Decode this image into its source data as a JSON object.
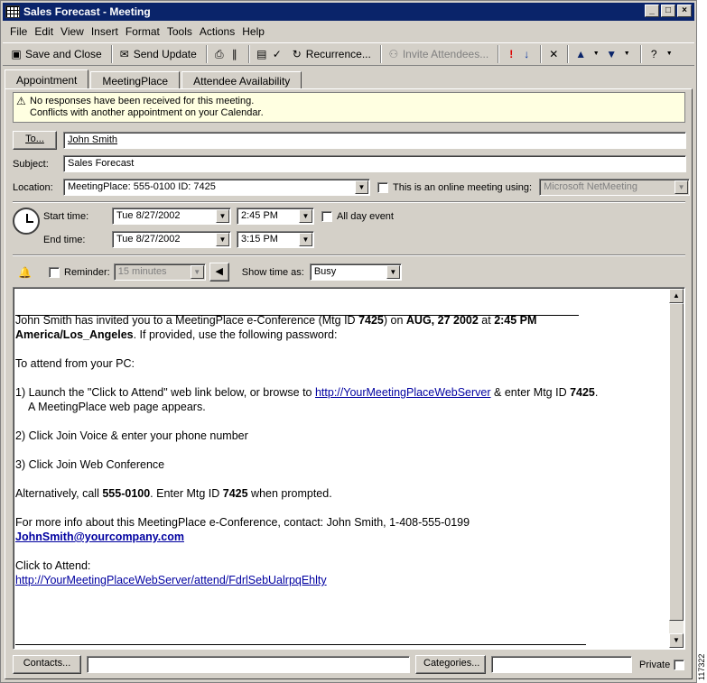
{
  "window": {
    "title": "Sales Forecast - Meeting",
    "controls": [
      "_",
      "□",
      "×"
    ]
  },
  "menu": [
    "File",
    "Edit",
    "View",
    "Insert",
    "Format",
    "Tools",
    "Actions",
    "Help"
  ],
  "toolbar": {
    "save_close": "Save and Close",
    "send_update": "Send Update",
    "recurrence": "Recurrence...",
    "invite": "Invite Attendees..."
  },
  "tabs": [
    "Appointment",
    "MeetingPlace",
    "Attendee Availability"
  ],
  "info": {
    "line1": "No responses have been received for this meeting.",
    "line2": "Conflicts with another appointment on your Calendar."
  },
  "to": {
    "button": "To...",
    "value": "John Smith"
  },
  "subject": {
    "label": "Subject:",
    "value": "Sales Forecast"
  },
  "location": {
    "label": "Location:",
    "value": "MeetingPlace: 555-0100  ID: 7425",
    "online_label": "This is an online meeting using:",
    "online_value": "Microsoft NetMeeting"
  },
  "time": {
    "start_label": "Start time:",
    "start_date": "Tue 8/27/2002",
    "start_time": "2:45 PM",
    "end_label": "End time:",
    "end_date": "Tue 8/27/2002",
    "end_time": "3:15 PM",
    "all_day": "All day event"
  },
  "reminder": {
    "label": "Reminder:",
    "value": "15 minutes",
    "show_as_label": "Show time as:",
    "show_as_value": "Busy"
  },
  "body": {
    "p1_a": "John Smith has invited you to a MeetingPlace e-Conference (Mtg ID ",
    "p1_id": "7425",
    "p1_b": ") on ",
    "p1_date": "AUG, 27 2002",
    "p1_c": " at ",
    "p1_time": "2:45 PM",
    "p1_tz": "America/Los_Angeles",
    "p1_d": ". If provided, use the following password:",
    "p2": "To attend from your PC:",
    "p3_a": "1) Launch the \"Click to Attend\" web link below, or browse to ",
    "p3_link": "http://YourMeetingPlaceWebServer",
    "p3_b": " & enter Mtg ID ",
    "p3_id": "7425",
    "p3_c": ".",
    "p3_d": "A MeetingPlace web page appears.",
    "p4": "2) Click Join Voice & enter your phone number",
    "p5": "3) Click Join Web Conference",
    "p6_a": "Alternatively, call  ",
    "p6_phone": "555-0100",
    "p6_b": ".  Enter Mtg ID ",
    "p6_id": "7425",
    "p6_c": " when prompted.",
    "p7": "For more info about this MeetingPlace e-Conference, contact: John Smith,  1-408-555-0199",
    "p7_email": "JohnSmith@yourcompany.com",
    "p8": "Click to Attend:",
    "p8_link": "http://YourMeetingPlaceWebServer/attend/FdrlSebUalrpqEhlty"
  },
  "footer": {
    "contacts": "Contacts...",
    "categories": "Categories...",
    "private": "Private"
  },
  "side_id": "117322"
}
